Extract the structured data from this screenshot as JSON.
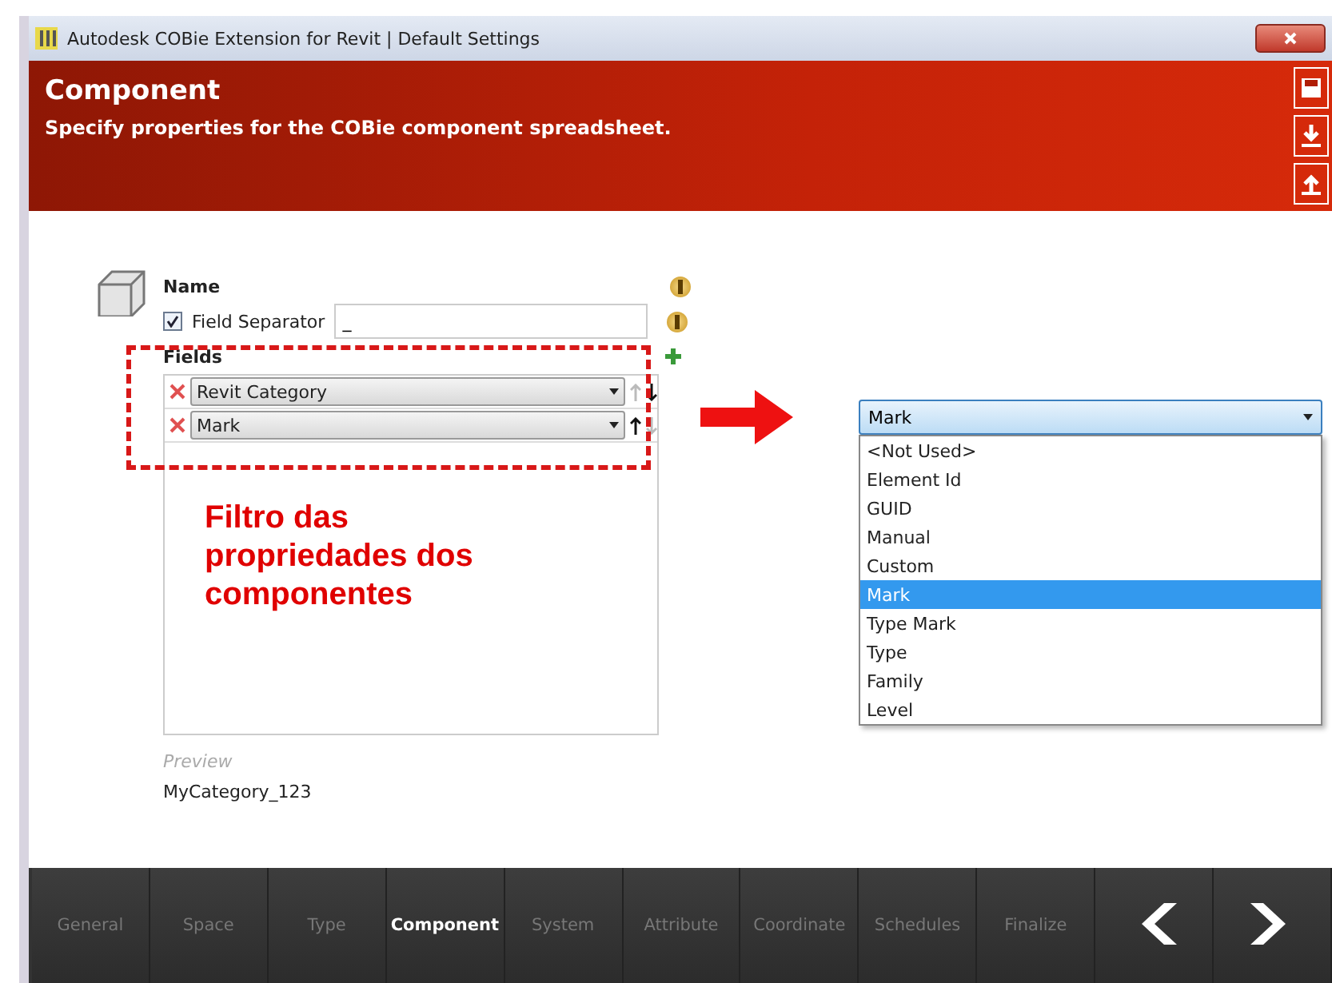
{
  "window": {
    "title": "Autodesk COBie Extension for Revit | Default Settings"
  },
  "header": {
    "title": "Component",
    "subtitle": "Specify properties for the COBie component spreadsheet."
  },
  "name": {
    "label": "Name"
  },
  "field_separator": {
    "label": "Field Separator",
    "checked": true,
    "value": "_"
  },
  "fields": {
    "label": "Fields",
    "rows": [
      {
        "value": "Revit Category",
        "up_enabled": false,
        "down_enabled": true
      },
      {
        "value": "Mark",
        "up_enabled": true,
        "down_enabled": false
      }
    ]
  },
  "annotation": {
    "text": "Filtro das propriedades dos componentes"
  },
  "preview": {
    "label": "Preview",
    "value": "MyCategory_123"
  },
  "dropdown": {
    "value": "Mark",
    "options": [
      {
        "label": "<Not Used>",
        "selected": false
      },
      {
        "label": "Element Id",
        "selected": false
      },
      {
        "label": "GUID",
        "selected": false
      },
      {
        "label": "Manual",
        "selected": false
      },
      {
        "label": "Custom",
        "selected": false
      },
      {
        "label": "Mark",
        "selected": true
      },
      {
        "label": "Type Mark",
        "selected": false
      },
      {
        "label": "Type",
        "selected": false
      },
      {
        "label": "Family",
        "selected": false
      },
      {
        "label": "Level",
        "selected": false
      }
    ]
  },
  "nav": {
    "tabs": [
      {
        "label": "General",
        "selected": false
      },
      {
        "label": "Space",
        "selected": false
      },
      {
        "label": "Type",
        "selected": false
      },
      {
        "label": "Component",
        "selected": true
      },
      {
        "label": "System",
        "selected": false
      },
      {
        "label": "Attribute",
        "selected": false
      },
      {
        "label": "Coordinate",
        "selected": false
      },
      {
        "label": "Schedules",
        "selected": false
      },
      {
        "label": "Finalize",
        "selected": false
      }
    ]
  }
}
